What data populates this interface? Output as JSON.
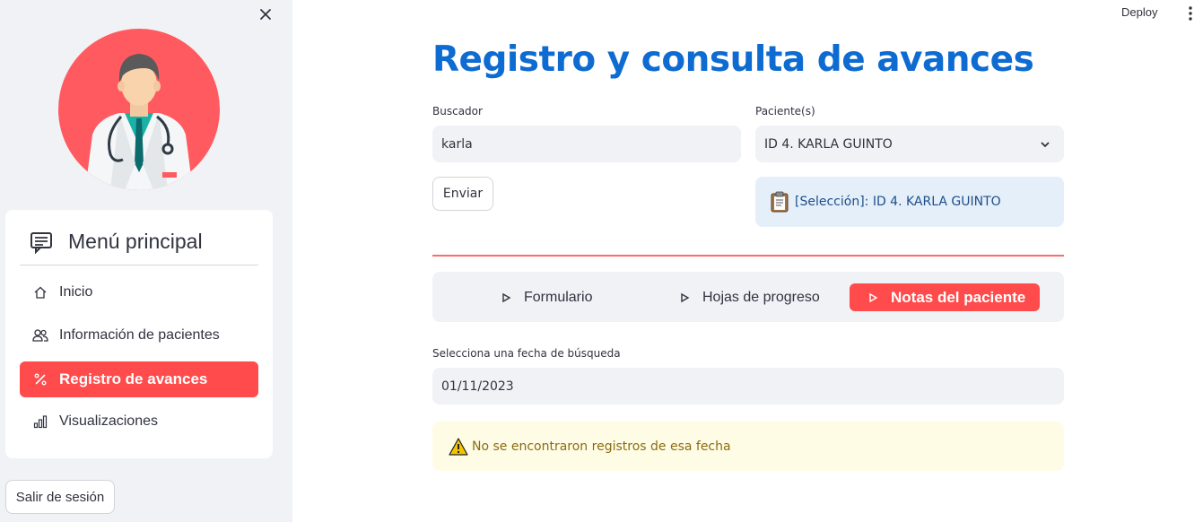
{
  "sidebar": {
    "menu_title": "Menú principal",
    "items": [
      {
        "label": "Inicio",
        "icon": "home-icon"
      },
      {
        "label": "Información de pacientes",
        "icon": "users-icon"
      },
      {
        "label": "Registro de avances",
        "icon": "percent-icon",
        "active": true
      },
      {
        "label": "Visualizaciones",
        "icon": "bar-chart-icon"
      }
    ],
    "logout_label": "Salir de sesión"
  },
  "header": {
    "deploy_label": "Deploy"
  },
  "main": {
    "title": "Registro y consulta de avances",
    "search": {
      "label": "Buscador",
      "value": "karla"
    },
    "patient_select": {
      "label": "Paciente(s)",
      "selected": "ID 4. KARLA GUINTO"
    },
    "submit_label": "Enviar",
    "selection_info": "[Selección]: ID 4. KARLA GUINTO",
    "tabs": [
      {
        "label": "Formulario"
      },
      {
        "label": "Hojas de progreso"
      },
      {
        "label": "Notas del paciente",
        "active": true
      }
    ],
    "date_field": {
      "label": "Selecciona una fecha de búsqueda",
      "value": "01/11/2023"
    },
    "warning": "No se encontraron registros de esa fecha"
  },
  "colors": {
    "accent": "#ff4b4b",
    "title_blue": "#0d6bd1",
    "sidebar_bg": "#f0f2f6",
    "info_bg": "#e5effa",
    "warning_bg": "#fffce6"
  }
}
